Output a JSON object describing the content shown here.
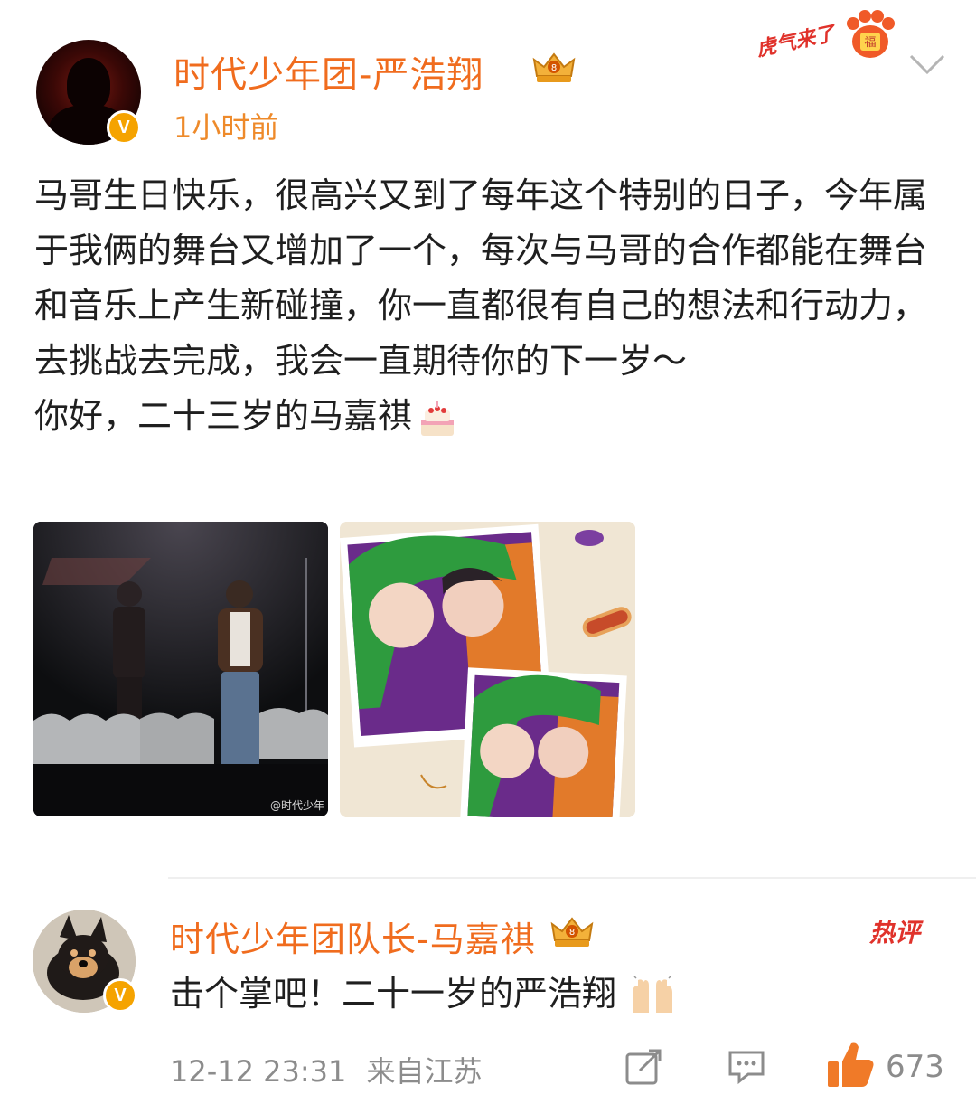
{
  "post": {
    "author": "时代少年团-严浩翔",
    "time": "1小时前",
    "verified_mark": "V",
    "decoration_text": "虎气来了",
    "paragraphs": [
      "马哥生日快乐，很高兴又到了每年这个特别的日子，今年属于我俩的舞台又增加了一个，每次与马哥的合作都能在舞台和音乐上产生新碰撞，你一直都很有自己的想法和行动力，去挑战去完成，我会一直期待你的下一岁～",
      "你好，二十三岁的马嘉祺"
    ],
    "photo1_watermark": "@时代少年",
    "icons": [
      "crown-badge-icon",
      "paw-badge-icon",
      "chevron-down-icon",
      "birthday-cake-emoji"
    ]
  },
  "comment": {
    "author": "时代少年团队长-马嘉祺",
    "text": "击个掌吧！二十一岁的严浩翔",
    "emoji": "raised-hands-emoji",
    "hot_label": "热评",
    "datetime": "12-12 23:31",
    "location": "来自江苏",
    "like_count": "673",
    "icons": [
      "share-icon",
      "comment-icon",
      "thumbs-up-icon"
    ]
  },
  "colors": {
    "username": "#f06c1e",
    "time": "#ee8a2a",
    "hot": "#e0322b",
    "verified": "#f5a300",
    "meta": "#8c8c8c"
  }
}
